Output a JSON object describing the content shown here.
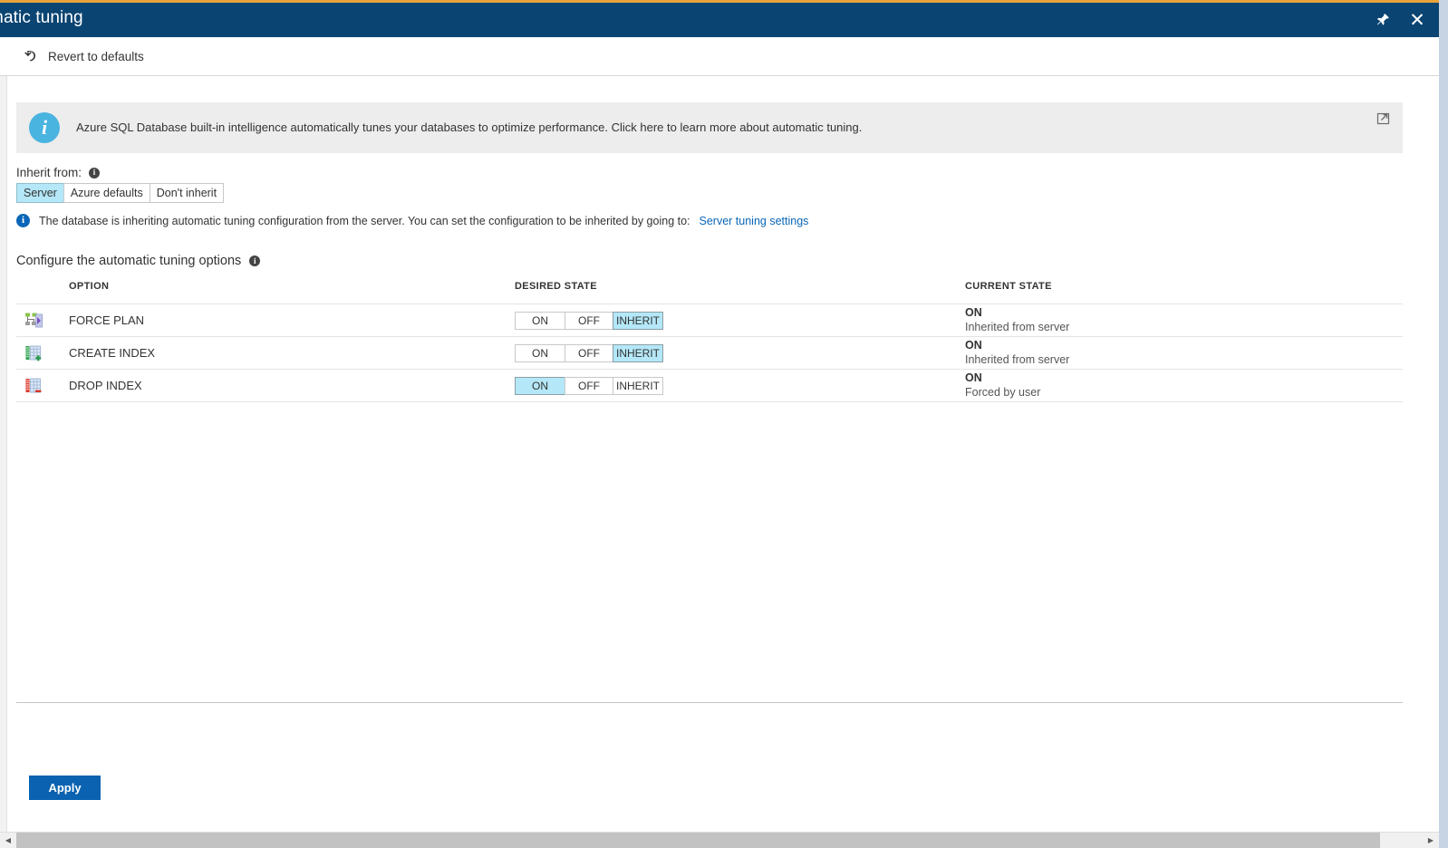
{
  "window": {
    "title": "tomatic tuning",
    "pin_icon": "pin-icon",
    "close_icon": "close-icon"
  },
  "toolbar": {
    "revert_label": "Revert to defaults",
    "revert_icon": "undo-arrow-icon"
  },
  "info_banner": {
    "icon": "info-circle-icon",
    "text": "Azure SQL Database built-in intelligence automatically tunes your databases to optimize performance. Click here to learn more about automatic tuning.",
    "external_link_icon": "external-link-icon"
  },
  "inherit": {
    "label": "Inherit from:",
    "info_icon": "info-icon",
    "options": [
      {
        "label": "Server",
        "selected": true
      },
      {
        "label": "Azure defaults",
        "selected": false
      },
      {
        "label": "Don't inherit",
        "selected": false
      }
    ],
    "status_icon": "info-circle-icon",
    "status_text": "The database is inheriting automatic tuning configuration from the server. You can set the configuration to be inherited by going to:",
    "status_link": "Server tuning settings"
  },
  "configure": {
    "title": "Configure the automatic tuning options",
    "info_icon": "info-icon",
    "columns": {
      "option": "OPTION",
      "desired_state": "DESIRED STATE",
      "current_state": "CURRENT STATE"
    },
    "segment_labels": {
      "on": "ON",
      "off": "OFF",
      "inherit": "INHERIT"
    },
    "rows": [
      {
        "icon": "force-plan-icon",
        "name": "FORCE PLAN",
        "desired_state": "INHERIT",
        "current_state": "ON",
        "current_reason": "Inherited from server"
      },
      {
        "icon": "create-index-icon",
        "name": "CREATE INDEX",
        "desired_state": "INHERIT",
        "current_state": "ON",
        "current_reason": "Inherited from server"
      },
      {
        "icon": "drop-index-icon",
        "name": "DROP INDEX",
        "desired_state": "ON",
        "current_state": "ON",
        "current_reason": "Forced by user"
      }
    ]
  },
  "footer": {
    "apply_label": "Apply"
  },
  "scrollbar": {
    "left_arrow_icon": "chevron-left-icon",
    "right_arrow_icon": "chevron-right-icon"
  },
  "colors": {
    "accent_orange": "#e9a33a",
    "title_bar": "#0a4472",
    "selected_segment": "#b4e7f7",
    "apply_button": "#0a62b0",
    "link": "#0a66b7",
    "info_icon": "#4ab4e0"
  }
}
